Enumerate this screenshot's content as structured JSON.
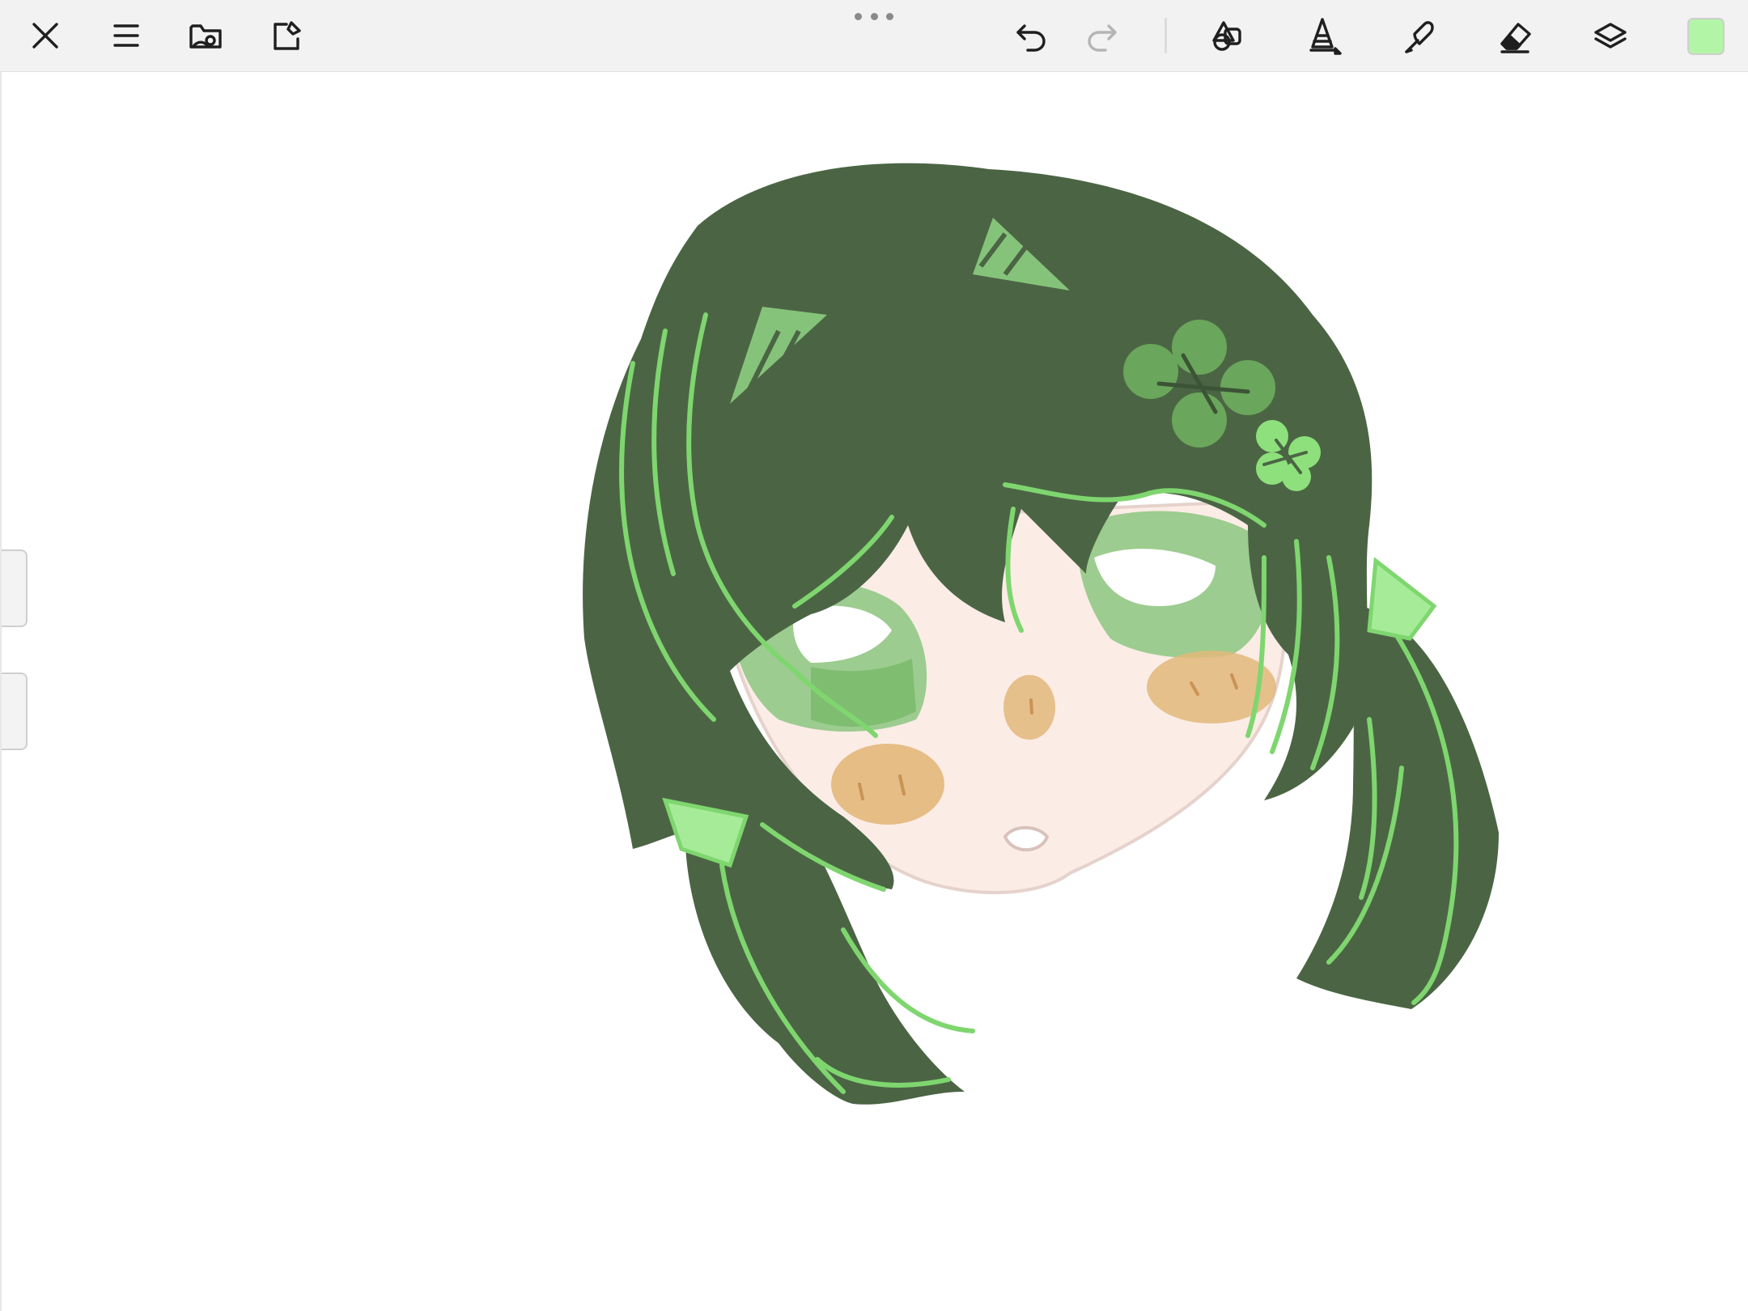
{
  "toolbar": {
    "left_tools": [
      {
        "name": "close-icon"
      },
      {
        "name": "menu-icon"
      },
      {
        "name": "gallery-folder-icon"
      },
      {
        "name": "share-icon"
      }
    ],
    "right_tools": [
      {
        "name": "undo-icon",
        "enabled": true
      },
      {
        "name": "redo-icon",
        "enabled": false
      },
      {
        "name": "shapes-icon"
      },
      {
        "name": "pen-tool-icon",
        "active": true
      },
      {
        "name": "lasso-icon"
      },
      {
        "name": "eraser-icon"
      },
      {
        "name": "layers-icon"
      }
    ],
    "current_color": "#b3f5a6"
  },
  "canvas": {
    "background": "#ffffff",
    "artwork": "chibi-girl-green-twintails"
  },
  "palette": {
    "hair_dark": "#4b6544",
    "hair_line": "#7fd66f",
    "hair_highlight": "#a6ec98",
    "skin": "#fbece6",
    "blush": "#e2b87a",
    "eye_green": "#86c37a"
  }
}
